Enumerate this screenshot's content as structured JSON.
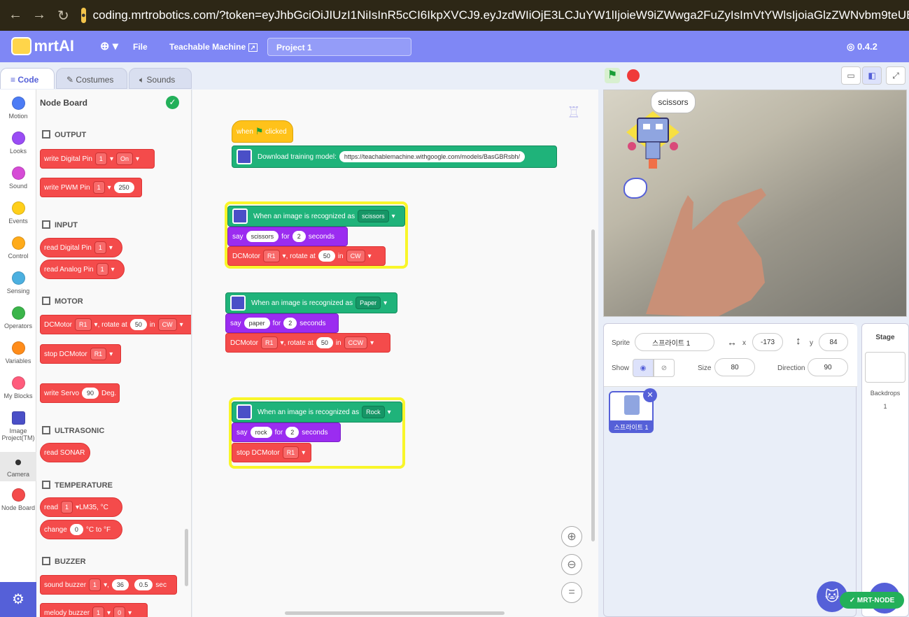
{
  "browser": {
    "url": "coding.mrtrobotics.com/?token=eyJhbGciOiJIUzI1NiIsInR5cCI6IkpXVCJ9.eyJzdWIiOjE3LCJuYW1lIjoieW9iZWwga2FuZyIsImVtYWlsIjoiaGlzZWNvbm9teUBnbWFpbC5jb20iLCJy"
  },
  "menubar": {
    "logo": "mrtAI",
    "file": "File",
    "teachable": "Teachable Machine",
    "project": "Project 1",
    "version": "0.4.2"
  },
  "tabs": {
    "code": "Code",
    "costumes": "Costumes",
    "sounds": "Sounds"
  },
  "categories": [
    {
      "label": "Motion",
      "color": "#4c7cf5"
    },
    {
      "label": "Looks",
      "color": "#9a4cf5"
    },
    {
      "label": "Sound",
      "color": "#d64cd6"
    },
    {
      "label": "Events",
      "color": "#ffcf1a"
    },
    {
      "label": "Control",
      "color": "#ffab1a"
    },
    {
      "label": "Sensing",
      "color": "#4cb0e0"
    },
    {
      "label": "Operators",
      "color": "#3bb54a"
    },
    {
      "label": "Variables",
      "color": "#ff8c1a"
    },
    {
      "label": "My Blocks",
      "color": "#ff5c7c"
    },
    {
      "label": "Image Project(TM)",
      "color": "#4a4fc7"
    },
    {
      "label": "Camera",
      "color": "#333333"
    },
    {
      "label": "Node Board",
      "color": "#f44b4b"
    }
  ],
  "palette": {
    "title": "Node Board",
    "output": "OUTPUT",
    "write_digital": "write Digital Pin",
    "pin1": "1",
    "on": "On",
    "write_pwm": "write PWM Pin",
    "pwm_val": "250",
    "input": "INPUT",
    "read_digital": "read Digital Pin",
    "read_analog": "read Analog Pin",
    "motor": "MOTOR",
    "dcmotor": "DCMotor",
    "r1": "R1",
    "rotate_at": ", rotate at",
    "speed": "50",
    "in": "in",
    "cw": "CW",
    "stop_dc": "stop DCMotor",
    "write_servo": "write Servo",
    "servo_val": "90",
    "deg": "Deg.",
    "ultrasonic": "ULTRASONIC",
    "read_sonar": "read SONAR",
    "temperature": "TEMPERATURE",
    "read": "read",
    "lm35": "LM35, °C",
    "change": "change",
    "zero": "0",
    "c_to_f": "°C to °F",
    "buzzer": "BUZZER",
    "sound_buzzer": "sound buzzer",
    "comma": ",",
    "freq": "36",
    "dur": "0.5",
    "sec": "sec",
    "melody_buzzer": "melody buzzer"
  },
  "script": {
    "when": "when",
    "clicked": "clicked",
    "download": "Download training model:",
    "model_url": "https://teachablemachine.withgoogle.com/models/BasGBRsbh/",
    "recognized": "When an image is recognized as",
    "say": "say",
    "for": "for",
    "seconds": "seconds",
    "two": "2",
    "scissors_dd": "scissors",
    "scissors_text": "scissors",
    "paper_dd": "Paper",
    "paper_text": "paper",
    "rock_dd": "Rock",
    "rock_text": "rock",
    "ccw": "CCW"
  },
  "stage": {
    "bubble": "scissors"
  },
  "sprite": {
    "sprite_label": "Sprite",
    "name": "스프라이트 1",
    "x_label": "x",
    "x": "-173",
    "y_label": "y",
    "y": "84",
    "show": "Show",
    "size_label": "Size",
    "size": "80",
    "direction_label": "Direction",
    "direction": "90",
    "thumb_label": "스프라이트 1"
  },
  "stagepanel": {
    "title": "Stage",
    "backdrops": "Backdrops",
    "count": "1"
  },
  "mrt_node": "MRT-NODE",
  "colors": {
    "accent": "#7f87f5",
    "nodeboard": "#f44b4b",
    "green": "#1fb37a",
    "purple": "#9b2cf0",
    "highlight": "#f9f62a"
  }
}
